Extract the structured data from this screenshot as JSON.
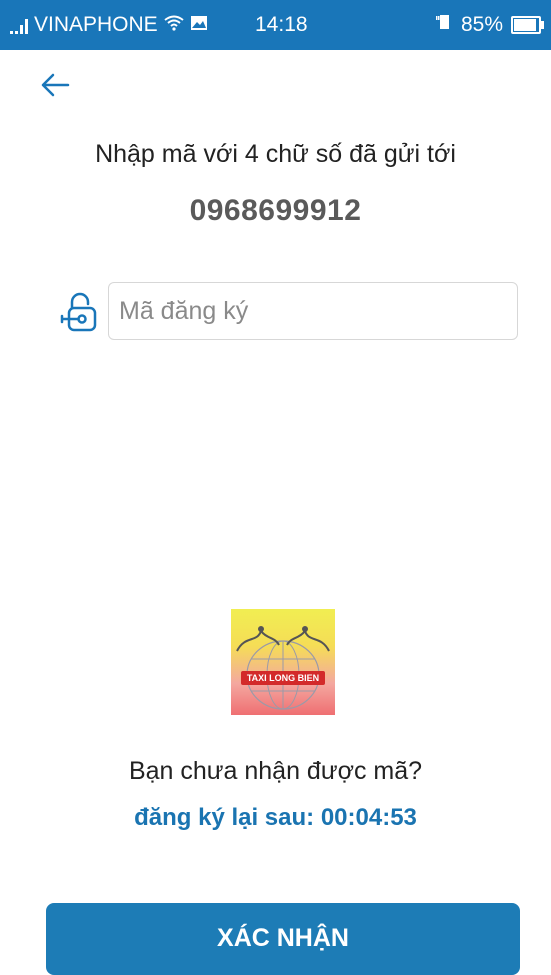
{
  "status_bar": {
    "carrier": "VINAPHONE",
    "time": "14:18",
    "battery": "85%",
    "background_color": "#1976b9"
  },
  "header": {
    "back_icon": "arrow-left-icon"
  },
  "instruction": "Nhập mã với 4 chữ số đã gửi tới",
  "phone_number": "0968699912",
  "code_field": {
    "icon": "unlock-icon",
    "placeholder": "Mã đăng ký",
    "value": ""
  },
  "logo": {
    "text": "TAXI LONG BIEN"
  },
  "no_code_text": "Bạn chưa nhận được mã?",
  "resend": {
    "label": "đăng ký lại sau:",
    "countdown": "00:04:53",
    "color": "#1a74b1"
  },
  "confirm_button": {
    "label": "XÁC NHẬN",
    "color": "#1d7cb6"
  }
}
